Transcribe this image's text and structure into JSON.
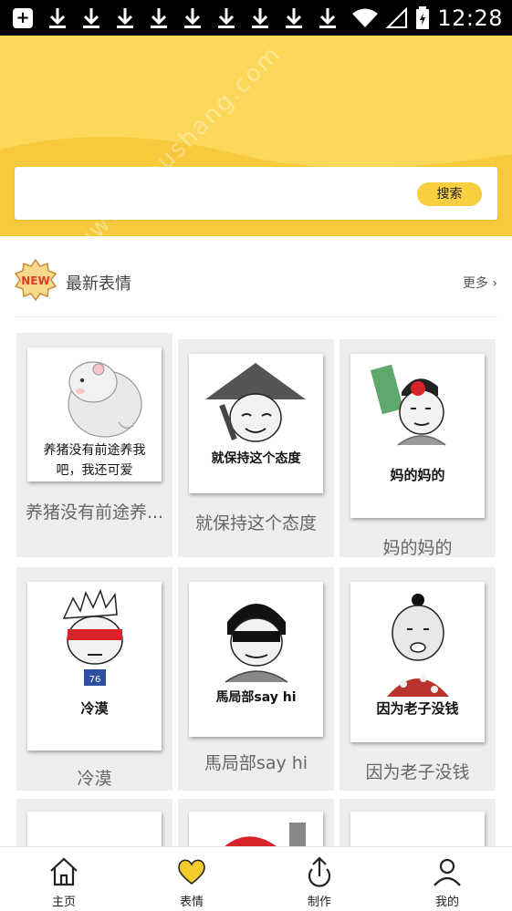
{
  "status_bar": {
    "time": "12:28",
    "icons": [
      "notification-plus-icon",
      "download-icon",
      "download-icon",
      "download-icon",
      "download-icon",
      "download-icon",
      "download-icon",
      "download-icon",
      "download-icon",
      "download-icon",
      "wifi-icon",
      "signal-icon",
      "battery-icon"
    ]
  },
  "header": {
    "color": "#fbd75a",
    "search": {
      "placeholder": "",
      "value": "",
      "button_label": "搜索"
    },
    "watermark": "www.shoushang.com"
  },
  "section": {
    "badge": "NEW",
    "title": "最新表情",
    "more_label": "更多",
    "more_icon": "chevron-right-icon"
  },
  "cards": [
    {
      "caption": "养猪没有前途养我吧，我还可爱",
      "title": "养猪没有前途养..."
    },
    {
      "caption": "就保持这个态度",
      "title": "就保持这个态度"
    },
    {
      "caption": "妈的妈的",
      "title": "妈的妈的"
    },
    {
      "caption": "冷漠",
      "title": "冷漠"
    },
    {
      "caption": "馬局部say hi",
      "title": "馬局部say hi"
    },
    {
      "caption": "因为老子没钱",
      "title": "因为老子没钱"
    },
    {
      "caption": "",
      "title": ""
    },
    {
      "caption": "",
      "title": ""
    },
    {
      "caption": "",
      "title": ""
    }
  ],
  "tabbar": {
    "tabs": [
      {
        "label": "主页",
        "icon": "home-icon",
        "active": false
      },
      {
        "label": "表情",
        "icon": "heart-icon",
        "active": true
      },
      {
        "label": "制作",
        "icon": "upload-icon",
        "active": false
      },
      {
        "label": "我的",
        "icon": "user-icon",
        "active": false
      }
    ]
  },
  "colors": {
    "accent": "#f7cf41",
    "header": "#fbd75a",
    "heart": "#f5cc2c"
  }
}
